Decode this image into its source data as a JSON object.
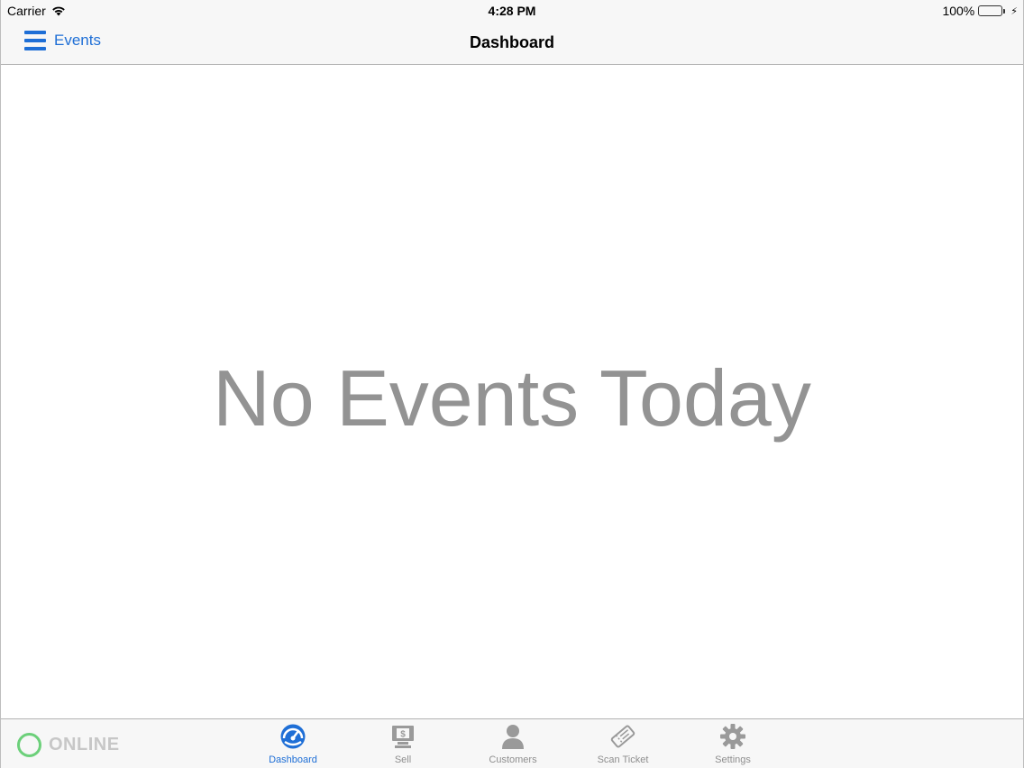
{
  "status_bar": {
    "carrier": "Carrier",
    "time": "4:28 PM",
    "battery": "100%"
  },
  "nav": {
    "back_label": "Events",
    "title": "Dashboard"
  },
  "main": {
    "empty_message": "No Events Today"
  },
  "connection": {
    "status": "ONLINE"
  },
  "tabs": [
    {
      "label": "Dashboard",
      "icon": "dashboard-icon",
      "active": true
    },
    {
      "label": "Sell",
      "icon": "sell-icon",
      "active": false
    },
    {
      "label": "Customers",
      "icon": "customers-icon",
      "active": false
    },
    {
      "label": "Scan Ticket",
      "icon": "ticket-icon",
      "active": false
    },
    {
      "label": "Settings",
      "icon": "gear-icon",
      "active": false
    }
  ],
  "colors": {
    "accent": "#1f6fd6",
    "online": "#6cd07a",
    "inactive": "#8e8e8e",
    "message": "#939393"
  }
}
